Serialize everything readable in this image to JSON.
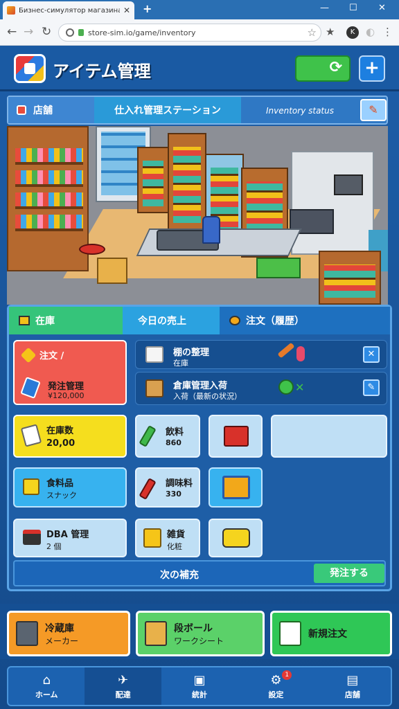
{
  "browser": {
    "tab_title": "Бизнес-симулятор магазина",
    "url": "store-sim.io/game/inventory",
    "new_tab": "+",
    "min": "—",
    "max": "☐",
    "close": "✕",
    "back": "←",
    "forward": "→",
    "reload": "↻",
    "bookmark": "☆",
    "menu": "⋮"
  },
  "header": {
    "title": "アイテム管理",
    "refresh_label": "⟳",
    "add_label": "+"
  },
  "info_bar": {
    "segment1": "店舗",
    "segment2": "仕入れ管理ステーション",
    "segment3": "Inventory status",
    "action_icon": "✎"
  },
  "panel": {
    "tabs": [
      {
        "label": "在庫"
      },
      {
        "label": "今日の売上"
      },
      {
        "label": "注文（履歴）"
      }
    ],
    "cards": {
      "red_top_label": "注文 /",
      "red_bottom_label": "発注管理",
      "red_bottom_sub": "¥120,000",
      "row1_label": "棚の整理",
      "row1_sub": "在庫",
      "row2_label": "倉庫管理入荷",
      "row2_sub": "入荷（最新の状況）",
      "yellow_label": "在庫数",
      "yellow_sub": "20,00",
      "g1_label": "飲料",
      "g1_sub": "860",
      "s1_label": "食料品",
      "s1_sub": "スナック",
      "g2_label": "調味料",
      "g2_sub": "330",
      "p1_label": "DBA 管理",
      "p1_sub": "2 個",
      "g3_label": "雑貨",
      "g3_sub": "化粧"
    },
    "footer_text": "次の補充",
    "footer_button": "発注する"
  },
  "actions": [
    {
      "title": "冷蔵庫",
      "sub": "メーカー"
    },
    {
      "title": "段ボール",
      "sub": "ワークシート"
    },
    {
      "title": "新規注文",
      "sub": ""
    }
  ],
  "nav": [
    {
      "label": "ホーム",
      "icon": "⌂"
    },
    {
      "label": "配達",
      "icon": "✈"
    },
    {
      "label": "統計",
      "icon": "▣"
    },
    {
      "label": "設定",
      "icon": "⚙",
      "badge": "1"
    },
    {
      "label": "店舗",
      "icon": "▤"
    }
  ]
}
